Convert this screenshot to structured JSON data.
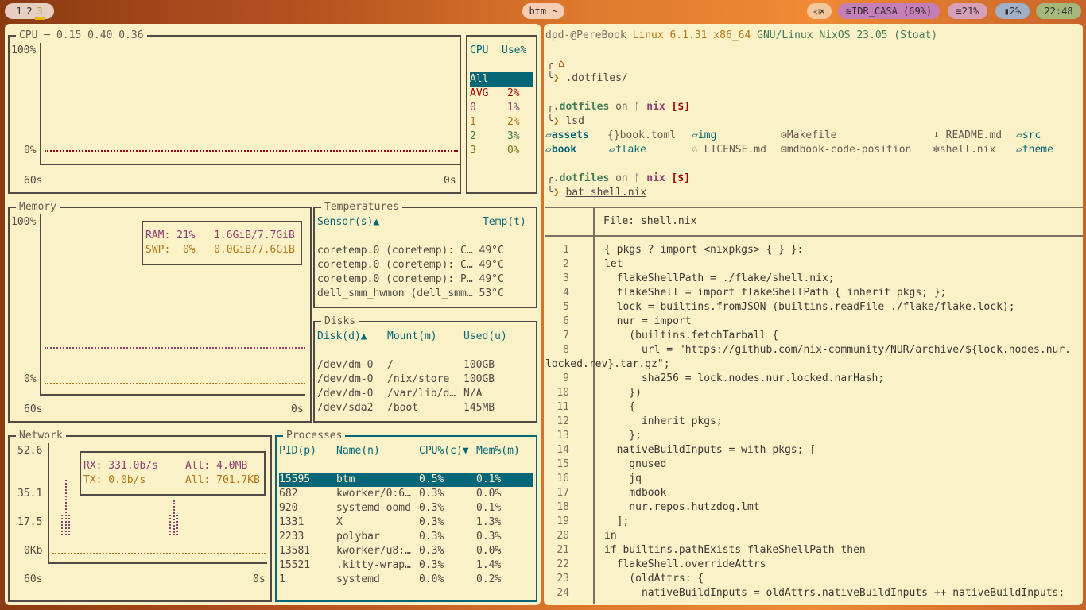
{
  "bar": {
    "workspaces": [
      "1",
      "2",
      "3"
    ],
    "active_workspace": "3",
    "window_title": "btm ~",
    "volume_icon": "muted-speaker",
    "wifi": "IDR_CASA (69%)",
    "memory": "21%",
    "cpu": "2%",
    "clock": "22:48"
  },
  "cpu": {
    "title": "CPU",
    "load": "0.15 0.40 0.36",
    "y_top": "100%",
    "y_bottom": "0%",
    "x_left": "60s",
    "x_right": "0s",
    "legend_header": [
      "CPU",
      "Use%"
    ],
    "rows": [
      {
        "name": "All",
        "use": ""
      },
      {
        "name": "AVG",
        "use": "2%"
      },
      {
        "name": "0",
        "use": "1%"
      },
      {
        "name": "1",
        "use": "2%"
      },
      {
        "name": "2",
        "use": "3%"
      },
      {
        "name": "3",
        "use": "0%"
      }
    ]
  },
  "memory": {
    "title": "Memory",
    "y_top": "100%",
    "y_bottom": "0%",
    "x_left": "60s",
    "x_right": "0s",
    "ram": "RAM: 21%   1.6GiB/7.7GiB",
    "swp": "SWP:  0%   0.0GiB/7.6GiB",
    "ram_pct": 21,
    "swp_pct": 0
  },
  "temps": {
    "title": "Temperatures",
    "col_sensor": "Sensor(s)▲",
    "col_temp": "Temp(t)",
    "rows": [
      {
        "sensor": "coretemp.0 (coretemp): C…",
        "temp": "49°C"
      },
      {
        "sensor": "coretemp.0 (coretemp): C…",
        "temp": "49°C"
      },
      {
        "sensor": "coretemp.0 (coretemp): P…",
        "temp": "49°C"
      },
      {
        "sensor": "dell_smm_hwmon (dell_smm…",
        "temp": "53°C"
      }
    ]
  },
  "disks": {
    "title": "Disks",
    "cols": [
      "Disk(d)▲",
      "Mount(m)",
      "Used(u)"
    ],
    "rows": [
      [
        "/dev/dm-0",
        "/",
        "100GB"
      ],
      [
        "/dev/dm-0",
        "/nix/store",
        "100GB"
      ],
      [
        "/dev/dm-0",
        "/var/lib/d…",
        "N/A"
      ],
      [
        "/dev/sda2",
        "/boot",
        "145MB"
      ]
    ]
  },
  "network": {
    "title": "Network",
    "y_labels": [
      "52.6",
      "35.1",
      "17.5",
      "0Kb"
    ],
    "x_left": "60s",
    "x_right": "0s",
    "rx": "RX: 331.0b/s",
    "rx_all": "All: 4.0MB",
    "tx": "TX: 0.0b/s",
    "tx_all": "All: 701.7KB"
  },
  "processes": {
    "title": "Processes",
    "cols": [
      "PID(p)",
      "Name(n)",
      "CPU%(c)▼",
      "Mem%(m)"
    ],
    "rows": [
      [
        "15595",
        "btm",
        "0.5%",
        "0.1%"
      ],
      [
        "682",
        "kworker/0:6…",
        "0.3%",
        "0.0%"
      ],
      [
        "920",
        "systemd-oomd",
        "0.3%",
        "0.1%"
      ],
      [
        "1331",
        "X",
        "0.3%",
        "1.3%"
      ],
      [
        "2233",
        "polybar",
        "0.3%",
        "0.3%"
      ],
      [
        "13581",
        "kworker/u8:…",
        "0.3%",
        "0.0%"
      ],
      [
        "15521",
        ".kitty-wrap…",
        "0.3%",
        "1.4%"
      ],
      [
        "1",
        "systemd",
        "0.0%",
        "0.2%"
      ]
    ]
  },
  "terminal": {
    "motd_user": "dpd-@PereBook",
    "motd_kernel": "Linux 6.1.31 x86_64",
    "motd_os": "GNU/Linux NixOS 23.05 (Stoat)",
    "cmd1": ".dotfiles/",
    "dir": ".dotfiles",
    "on": "on",
    "branch_icon": "git-branch",
    "branch": "nix",
    "status": "[$]",
    "cmd2": "lsd",
    "cmd3": "bat shell.nix",
    "lsd_row1": [
      "assets",
      "book.toml",
      "img",
      "Makefile",
      "README.md",
      "src"
    ],
    "lsd_row2": [
      "book",
      "flake",
      "LICENSE.md",
      "mdbook-code-position",
      "shell.nix",
      "theme"
    ],
    "bat_file": "File: shell.nix",
    "lines": [
      "{ pkgs ? import <nixpkgs> { } }:",
      "let",
      "  flakeShellPath = ./flake/shell.nix;",
      "  flakeShell = import flakeShellPath { inherit pkgs; };",
      "  lock = builtins.fromJSON (builtins.readFile ./flake/flake.lock);",
      "  nur = import",
      "    (builtins.fetchTarball {",
      "      url = \"https://github.com/nix-community/NUR/archive/${lock.nodes.nur.",
      "locked.rev}.tar.gz\";",
      "      sha256 = lock.nodes.nur.locked.narHash;",
      "    })",
      "    {",
      "      inherit pkgs;",
      "    };",
      "  nativeBuildInputs = with pkgs; [",
      "    gnused",
      "    jq",
      "    mdbook",
      "    nur.repos.hutzdog.lmt",
      "  ];",
      "in",
      "if builtins.pathExists flakeShellPath then",
      "  flakeShell.overrideAttrs",
      "    (oldAttrs: {",
      "      nativeBuildInputs = oldAttrs.nativeBuildInputs ++ nativeBuildInputs;"
    ],
    "line_numbers": [
      "1",
      "2",
      "3",
      "4",
      "5",
      "6",
      "7",
      "8",
      "",
      "9",
      "10",
      "11",
      "12",
      "13",
      "14",
      "15",
      "16",
      "17",
      "18",
      "19",
      "20",
      "21",
      "22",
      "23",
      "24"
    ]
  }
}
